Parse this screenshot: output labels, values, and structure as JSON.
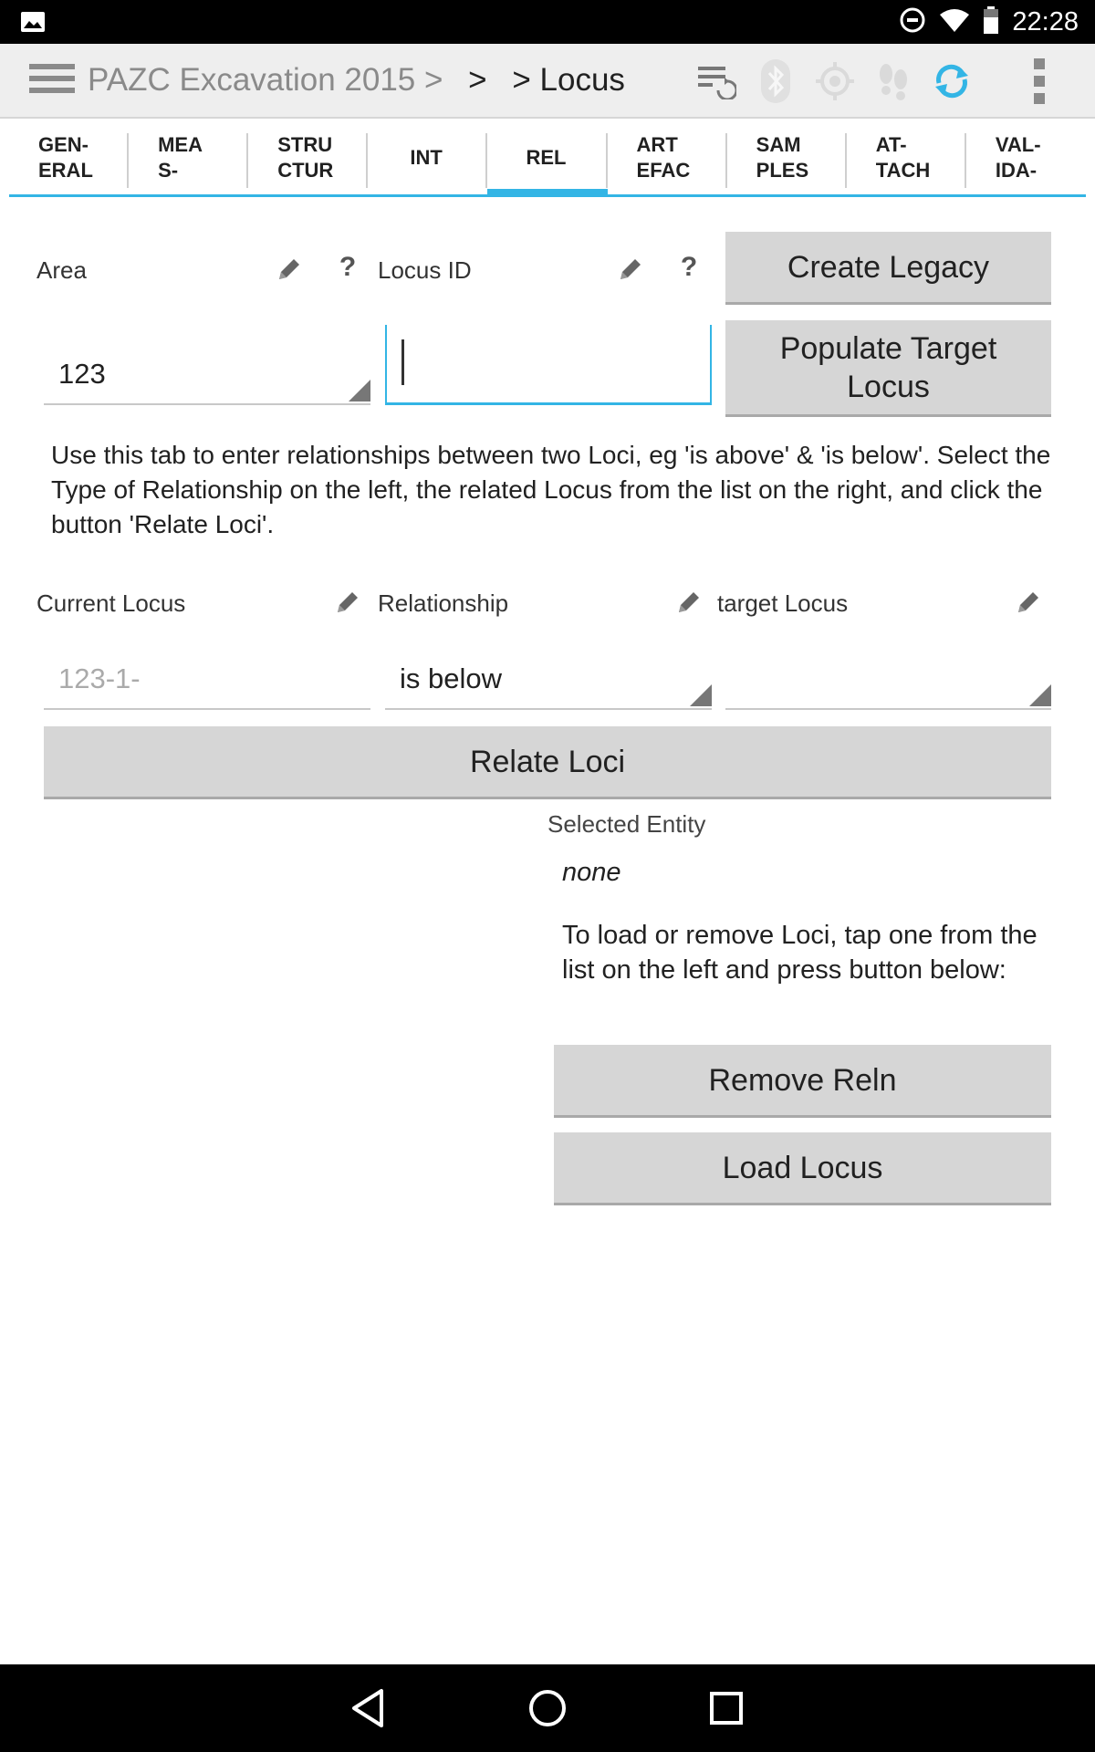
{
  "status_bar": {
    "time": "22:28",
    "icons": [
      "image-icon",
      "do-not-disturb-icon",
      "wifi-icon",
      "battery-icon"
    ]
  },
  "action_bar": {
    "breadcrumb_project": "PAZC Excavation 2015 >",
    "breadcrumb_middle": ">",
    "breadcrumb_current": "> Locus",
    "icons": [
      "menu-icon",
      "sync-settings-icon",
      "bluetooth-icon",
      "gps-icon",
      "tracker-icon",
      "sync-icon",
      "overflow-menu-icon"
    ],
    "sync_color": "#33b5e5"
  },
  "tabs": [
    {
      "label_line1": "GEN-",
      "label_line2": "ERAL"
    },
    {
      "label_line1": "MEA",
      "label_line2": "S-"
    },
    {
      "label_line1": "STRU",
      "label_line2": "CTUR"
    },
    {
      "label_line1": "INT",
      "label_line2": ""
    },
    {
      "label_line1": "REL",
      "label_line2": ""
    },
    {
      "label_line1": "ART",
      "label_line2": "EFAC"
    },
    {
      "label_line1": "SAM",
      "label_line2": "PLES"
    },
    {
      "label_line1": "AT-",
      "label_line2": "TACH"
    },
    {
      "label_line1": "VAL-",
      "label_line2": "IDA-"
    }
  ],
  "active_tab": "REL",
  "accent_color": "#33b5e5",
  "form": {
    "area_label": "Area",
    "area_value": "123",
    "locus_id_label": "Locus ID",
    "locus_id_value": "",
    "help_symbol": "?",
    "create_legacy_button": "Create Legacy",
    "populate_target_button_line1": "Populate Target",
    "populate_target_button_line2": "Locus",
    "description": "Use this tab to enter relationships between two Loci, eg 'is above' & 'is below'. Select the Type of Relationship on the left, the related Locus from the list on the right, and click the button 'Relate Loci'.",
    "current_locus_label": "Current Locus",
    "current_locus_placeholder": "123-1-",
    "relationship_label": "Relationship",
    "relationship_value": "is below",
    "target_locus_label": "target Locus",
    "target_locus_value": "",
    "relate_button": "Relate Loci",
    "selected_entity_label": "Selected Entity",
    "selected_entity_value": "none",
    "load_instructions": "To load or remove Loci, tap one from the list on the left and press button below:",
    "remove_button": "Remove Reln",
    "load_button": "Load Locus"
  }
}
